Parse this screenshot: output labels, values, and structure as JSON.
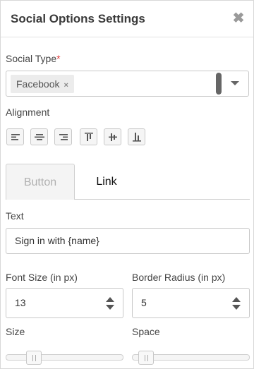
{
  "header": {
    "title": "Social Options Settings",
    "close_icon": "close-icon"
  },
  "social_type": {
    "label": "Social Type",
    "required_mark": "*",
    "selected_tags": [
      "Facebook"
    ],
    "remove_icon": "×",
    "dropdown_icon": "chevron-down-icon"
  },
  "alignment": {
    "label": "Alignment",
    "options": [
      "align-left",
      "align-center",
      "align-right",
      "align-top",
      "align-middle",
      "align-bottom"
    ]
  },
  "tabs": {
    "button": "Button",
    "link": "Link",
    "active": "Button"
  },
  "text_field": {
    "label": "Text",
    "value": "Sign in with {name}"
  },
  "font_size": {
    "label": "Font Size (in px)",
    "value": "13"
  },
  "border_radius": {
    "label": "Border Radius (in px)",
    "value": "5"
  },
  "size": {
    "label": "Size",
    "level": 0.2
  },
  "space": {
    "label": "Space",
    "level": 0.06
  },
  "colors": {
    "required": "#e03a3a",
    "inactive_tab_text": "#b0b0b0"
  }
}
